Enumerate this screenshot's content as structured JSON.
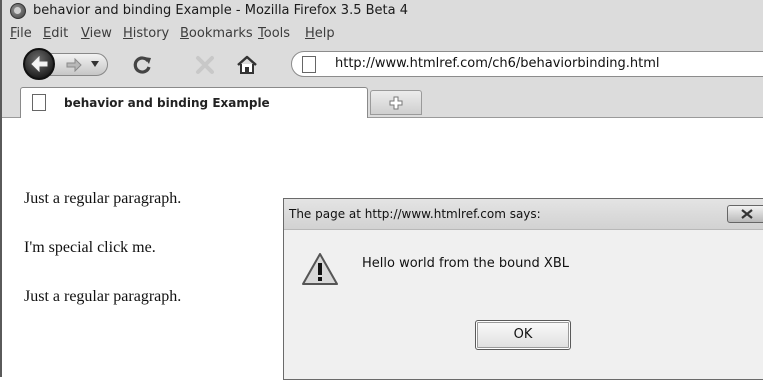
{
  "window": {
    "title": "behavior and binding Example - Mozilla Firefox 3.5 Beta 4"
  },
  "menu": {
    "items": [
      "File",
      "Edit",
      "View",
      "History",
      "Bookmarks",
      "Tools",
      "Help"
    ]
  },
  "navigation": {
    "url": "http://www.htmlref.com/ch6/behaviorbinding.html",
    "icons": [
      "back-icon",
      "forward-icon",
      "reload-icon",
      "stop-icon",
      "home-icon",
      "page-icon"
    ]
  },
  "tabs": {
    "active_label": "behavior and binding Example",
    "new_tab_icon": "plus-icon"
  },
  "page": {
    "paragraphs": [
      "Just a regular paragraph.",
      "I'm special click me.",
      "Just a regular paragraph."
    ]
  },
  "dialog": {
    "title": "The page at http://www.htmlref.com says:",
    "message": "Hello world from the bound XBL",
    "ok_label": "OK",
    "icon": "warning-icon"
  },
  "colors": {
    "chrome": "#dcdcdc",
    "dialog_bg": "#f0f0f0",
    "warning_fill": "#d8d8d8"
  }
}
